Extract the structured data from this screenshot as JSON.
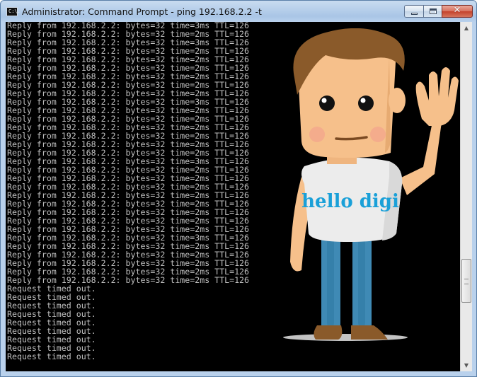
{
  "window": {
    "title": "Administrator: Command Prompt - ping  192.168.2.2 -t",
    "icon_text": "C:\\.",
    "buttons": {
      "minimize": "minimize",
      "maximize": "maximize",
      "close": "✕"
    }
  },
  "console": {
    "lines": [
      "Reply from 192.168.2.2: bytes=32 time=3ms TTL=126",
      "Reply from 192.168.2.2: bytes=32 time=2ms TTL=126",
      "Reply from 192.168.2.2: bytes=32 time=3ms TTL=126",
      "Reply from 192.168.2.2: bytes=32 time=2ms TTL=126",
      "Reply from 192.168.2.2: bytes=32 time=2ms TTL=126",
      "Reply from 192.168.2.2: bytes=32 time=2ms TTL=126",
      "Reply from 192.168.2.2: bytes=32 time=2ms TTL=126",
      "Reply from 192.168.2.2: bytes=32 time=2ms TTL=126",
      "Reply from 192.168.2.2: bytes=32 time=2ms TTL=126",
      "Reply from 192.168.2.2: bytes=32 time=3ms TTL=126",
      "Reply from 192.168.2.2: bytes=32 time=2ms TTL=126",
      "Reply from 192.168.2.2: bytes=32 time=2ms TTL=126",
      "Reply from 192.168.2.2: bytes=32 time=2ms TTL=126",
      "Reply from 192.168.2.2: bytes=32 time=2ms TTL=126",
      "Reply from 192.168.2.2: bytes=32 time=2ms TTL=126",
      "Reply from 192.168.2.2: bytes=32 time=2ms TTL=126",
      "Reply from 192.168.2.2: bytes=32 time=3ms TTL=126",
      "Reply from 192.168.2.2: bytes=32 time=2ms TTL=126",
      "Reply from 192.168.2.2: bytes=32 time=2ms TTL=126",
      "Reply from 192.168.2.2: bytes=32 time=2ms TTL=126",
      "Reply from 192.168.2.2: bytes=32 time=2ms TTL=126",
      "Reply from 192.168.2.2: bytes=32 time=2ms TTL=126",
      "Reply from 192.168.2.2: bytes=32 time=2ms TTL=126",
      "Reply from 192.168.2.2: bytes=32 time=2ms TTL=126",
      "Reply from 192.168.2.2: bytes=32 time=2ms TTL=126",
      "Reply from 192.168.2.2: bytes=32 time=3ms TTL=126",
      "Reply from 192.168.2.2: bytes=32 time=2ms TTL=126",
      "Reply from 192.168.2.2: bytes=32 time=2ms TTL=126",
      "Reply from 192.168.2.2: bytes=32 time=2ms TTL=126",
      "Reply from 192.168.2.2: bytes=32 time=2ms TTL=126",
      "Reply from 192.168.2.2: bytes=32 time=2ms TTL=126",
      "Request timed out.",
      "Request timed out.",
      "Request timed out.",
      "Request timed out.",
      "Request timed out.",
      "Request timed out.",
      "Request timed out.",
      "Request timed out.",
      "Request timed out."
    ]
  },
  "scrollbar": {
    "up_icon": "▲",
    "down_icon": "▼",
    "position": 0.73
  },
  "mascot": {
    "shirt_text": "hello digi"
  },
  "colors": {
    "console_bg": "#000000",
    "console_text": "#c0c0c0",
    "shirt_text": "#1aa0d8",
    "close_button": "#c4412b"
  }
}
